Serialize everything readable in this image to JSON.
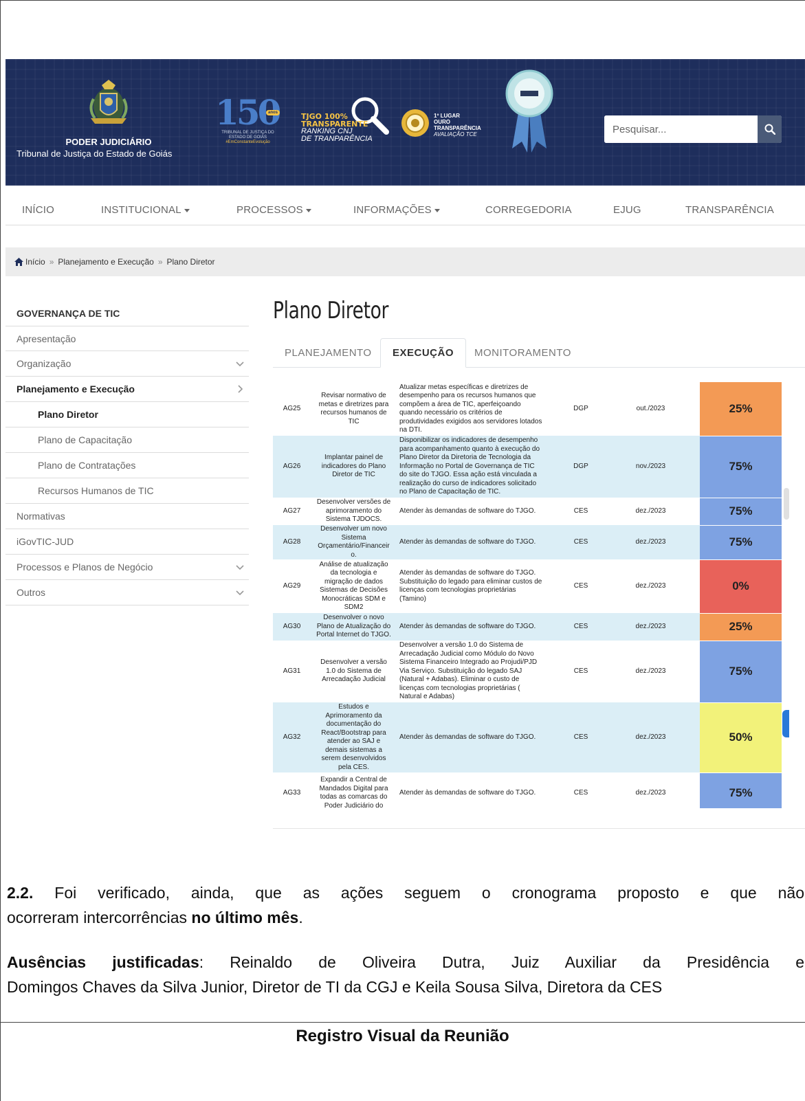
{
  "header": {
    "brand_title": "PODER JUDICIÁRIO",
    "brand_subtitle": "Tribunal de Justiça do Estado de Goiás",
    "badge150": {
      "number": "150",
      "anos": "anos",
      "line1": "TRIBUNAL DE JUSTIÇA DO",
      "line2": "ESTADO DE GOIÁS",
      "tag": "#EmConstanteEvolução"
    },
    "tjgo": {
      "line1": "TJGO 100%",
      "line2": "TRANSPARENTE",
      "line3": "RANKING CNJ",
      "line4": "DE TRANPARÊNCIA"
    },
    "ouro": {
      "line1": "1º LUGAR",
      "line2": "OURO",
      "line3": "TRANSPARÊNCIA",
      "line4": "AVALIAÇÃO TCE"
    },
    "search_placeholder": "Pesquisar..."
  },
  "nav": {
    "items": [
      {
        "label": "INÍCIO"
      },
      {
        "label": "INSTITUCIONAL"
      },
      {
        "label": "PROCESSOS"
      },
      {
        "label": "INFORMAÇÕES"
      },
      {
        "label": "CORREGEDORIA"
      },
      {
        "label": "EJUG"
      },
      {
        "label": "TRANSPARÊNCIA"
      }
    ]
  },
  "breadcrumb": {
    "home": "Início",
    "sep": "»",
    "level1": "Planejamento e Execução",
    "level2": "Plano Diretor"
  },
  "sidebar": {
    "heading": "GOVERNANÇA DE TIC",
    "items": [
      {
        "label": "Apresentação"
      },
      {
        "label": "Organização"
      },
      {
        "label": "Planejamento e Execução"
      },
      {
        "label": "Plano Diretor"
      },
      {
        "label": "Plano de Capacitação"
      },
      {
        "label": "Plano de Contratações"
      },
      {
        "label": "Recursos Humanos de TIC"
      },
      {
        "label": "Normativas"
      },
      {
        "label": "iGovTIC-JUD"
      },
      {
        "label": "Processos e Planos de Negócio"
      },
      {
        "label": "Outros"
      }
    ]
  },
  "main": {
    "title": "Plano Diretor",
    "tabs": [
      {
        "label": "PLANEJAMENTO"
      },
      {
        "label": "EXECUÇÃO"
      },
      {
        "label": "MONITORAMENTO"
      }
    ]
  },
  "table": {
    "rows": [
      {
        "code": "AG25",
        "name": [
          "Revisar normativo de",
          "metas e diretrizes para",
          "recursos humanos de",
          "TIC"
        ],
        "desc": [
          "Atualizar metas específicas e diretrizes de",
          "desempenho para os recursos humanos que",
          "compõem a área de TIC, aperfeiçoando",
          "quando necessário os critérios de",
          "produtividades exigidos aos servidores lotados",
          "na DTI."
        ],
        "area": "DGP",
        "date": "out./2023",
        "pct": "25%",
        "color": "#f39a55"
      },
      {
        "code": "AG26",
        "name": [
          "Implantar painel de",
          "indicadores do Plano",
          "Diretor de TIC"
        ],
        "desc": [
          "Disponibilizar os indicadores de desempenho",
          "para acompanhamento quanto à execução do",
          "Plano Diretor da Diretoria de Tecnologia da",
          "Informação no Portal de Governança de TIC",
          "do site do TJGO. Essa ação está vinculada a",
          "realização do curso de indicadores solicitado",
          "no Plano de Capacitação de TIC."
        ],
        "area": "DGP",
        "date": "nov./2023",
        "pct": "75%",
        "color": "#7ea2e2"
      },
      {
        "code": "AG27",
        "name": [
          "Desenvolver versões de",
          "aprimoramento do",
          "Sistema TJDOCS."
        ],
        "desc": [
          "Atender às demandas de software do TJGO."
        ],
        "area": "CES",
        "date": "dez./2023",
        "pct": "75%",
        "color": "#7ea2e2"
      },
      {
        "code": "AG28",
        "name": [
          "Desenvolver um novo",
          "Sistema",
          "Orçamentário/Financeir",
          "o."
        ],
        "desc": [
          "Atender às demandas de software do TJGO."
        ],
        "area": "CES",
        "date": "dez./2023",
        "pct": "75%",
        "color": "#7ea2e2"
      },
      {
        "code": "AG29",
        "name": [
          "Análise de atualização",
          "da tecnologia e",
          "migração de dados",
          "Sistemas de Decisões",
          "Monocráticas SDM e",
          "SDM2"
        ],
        "desc": [
          "Atender às demandas de software do TJGO.",
          "Substituição do legado para eliminar custos de",
          "licenças com tecnologias proprietárias",
          "(Tamino)"
        ],
        "area": "CES",
        "date": "dez./2023",
        "pct": "0%",
        "color": "#e8625a"
      },
      {
        "code": "AG30",
        "name": [
          "Desenvolver o novo",
          "Plano de Atualização do",
          "Portal Internet do TJGO."
        ],
        "desc": [
          "Atender às demandas de software do TJGO."
        ],
        "area": "CES",
        "date": "dez./2023",
        "pct": "25%",
        "color": "#f39a55"
      },
      {
        "code": "AG31",
        "name": [
          "Desenvolver a versão",
          "1.0 do Sistema de",
          "Arrecadação Judicial"
        ],
        "desc": [
          "Desenvolver a versão 1.0 do Sistema de",
          "Arrecadação Judicial como Módulo do Novo",
          "Sistema Financeiro Integrado ao Projudi/PJD",
          "Via Serviço. Substituição do legado SAJ",
          "(Natural + Adabas). Eliminar o custo de",
          "licenças com tecnologias proprietárias (",
          "Natural e Adabas)"
        ],
        "area": "CES",
        "date": "dez./2023",
        "pct": "75%",
        "color": "#7ea2e2"
      },
      {
        "code": "AG32",
        "name": [
          "Estudos e",
          "Aprimoramento da",
          "documentação do",
          "React/Bootstrap para",
          "atender ao SAJ e",
          "demais sistemas a",
          "serem desenvolvidos",
          "pela CES."
        ],
        "desc": [
          "Atender às demandas de software do TJGO."
        ],
        "area": "CES",
        "date": "dez./2023",
        "pct": "50%",
        "color": "#f2f27a"
      },
      {
        "code": "AG33",
        "name": [
          "Expandir a Central de",
          "Mandados Digital para",
          "todas as comarcas do",
          "Poder Judiciário do"
        ],
        "desc": [
          "Atender às demandas de software do TJGO."
        ],
        "area": "CES",
        "date": "dez./2023",
        "pct": "75%",
        "color": "#7ea2e2"
      }
    ]
  },
  "doc": {
    "p1_bold": "2.2.",
    "p1_text1": " Foi verificado, ainda, que as ações seguem o cronograma proposto e que não",
    "p1_text2": "ocorreram intercorrências ",
    "p1_bold2": "no último mês",
    "p1_end": ".",
    "p2_bold": "Ausências justificadas",
    "p2_text1": ": Reinaldo de Oliveira Dutra, Juiz Auxiliar da Presidência e",
    "p2_text2": "Domingos Chaves da Silva Junior, Diretor de TI da CGJ e Keila Sousa Silva, Diretora da CES",
    "caption": "Registro Visual da Reunião"
  }
}
